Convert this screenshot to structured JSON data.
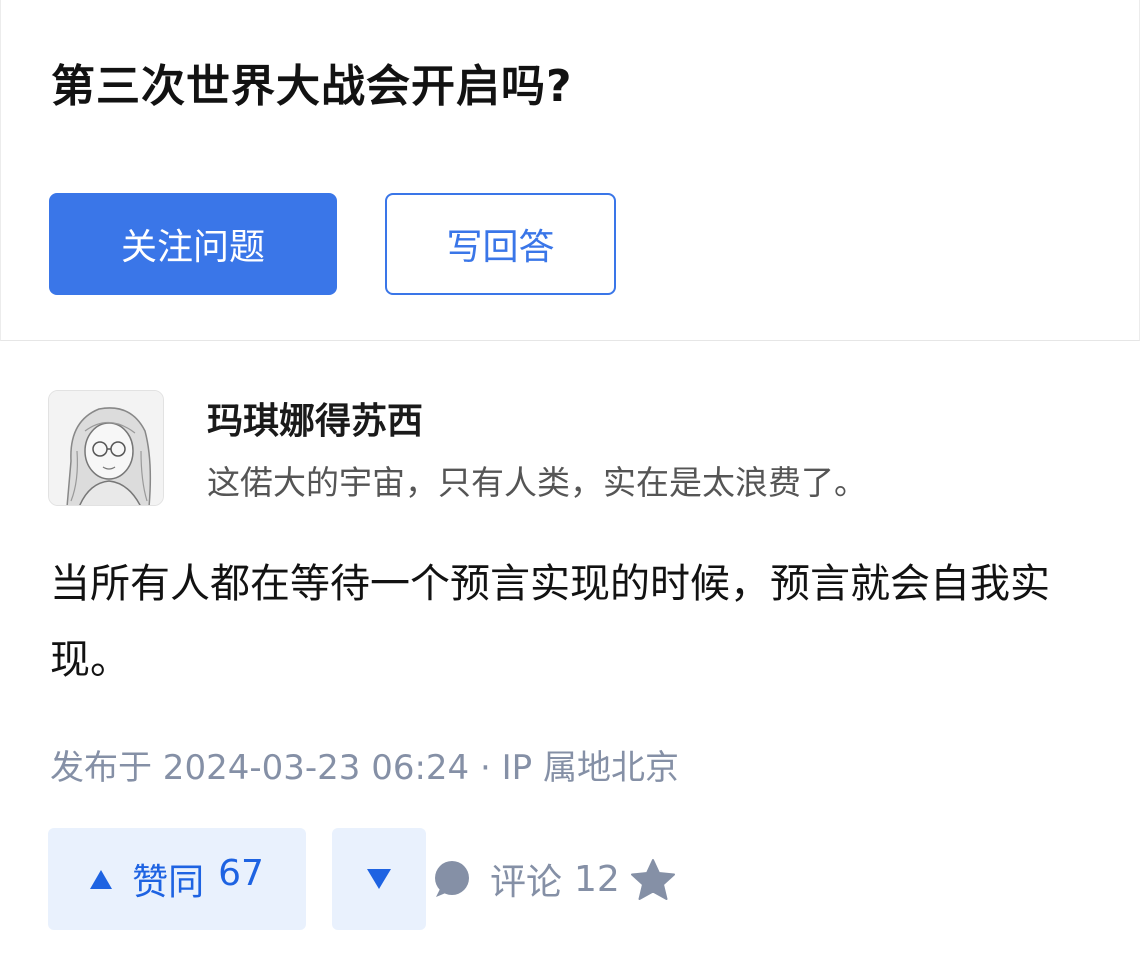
{
  "question": {
    "title": "第三次世界大战会开启吗?",
    "follow_label": "关注问题",
    "answer_label": "写回答"
  },
  "answer": {
    "author": {
      "name": "玛琪娜得苏西",
      "bio": "这偌大的宇宙，只有人类，实在是太浪费了。"
    },
    "content": "当所有人都在等待一个预言实现的时候，预言就会自我实现。",
    "meta": "发布于 2024-03-23 06:24 · IP 属地北京"
  },
  "actions": {
    "vote_up_label": "赞同",
    "vote_up_count": "67",
    "comment_label": "评论",
    "comment_count": "12"
  },
  "icons": {
    "vote_up": "triangle-up-icon",
    "vote_down": "triangle-down-icon",
    "comment": "speech-bubble-icon",
    "favorite": "star-icon"
  },
  "colors": {
    "accent": "#3a76e8",
    "vote_bg": "#e9f1fd",
    "vote_fg": "#1e63e2",
    "muted": "#8590a6"
  }
}
